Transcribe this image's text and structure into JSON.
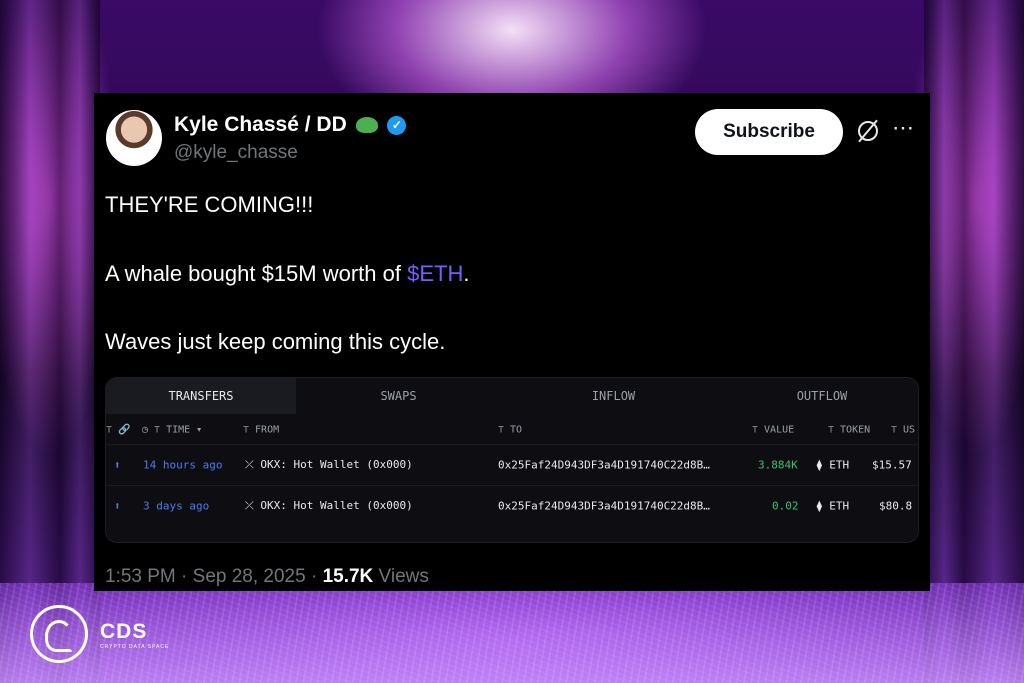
{
  "background": {
    "accent": "#b93cff"
  },
  "tweet": {
    "author_name": "Kyle Chassé / DD",
    "handle": "@kyle_chasse",
    "subscribe_label": "Subscribe",
    "more_icon": "⋯",
    "line1": "THEY'RE COMING!!!",
    "line2_prefix": "A whale bought $15M worth of ",
    "line2_cashtag": "$ETH",
    "line2_suffix": ".",
    "line3": "Waves just keep coming this cycle.",
    "time": "1:53 PM · Sep 28, 2025 · ",
    "views_count": "15.7K",
    "views_label": " Views",
    "cashtag_color": "#7a5cff",
    "verified_color": "#1d9bf0"
  },
  "panel": {
    "tabs": [
      "TRANSFERS",
      "SWAPS",
      "INFLOW",
      "OUTFLOW"
    ],
    "headers": {
      "link_icons": "⊤ 🔗",
      "time": "◷ ⊤ TIME ▾",
      "from": "⊤ FROM",
      "to": "⊤ TO",
      "value": "⊤ VALUE",
      "token": "⊤ TOKEN",
      "usd": "⊤ US"
    },
    "rows": [
      {
        "icon": "⬆",
        "time": "14 hours ago",
        "from": "⤫ OKX: Hot Wallet (0x000)",
        "to": "0x25Faf24D943DF3a4D191740C22d8B…",
        "value": "3.884K",
        "token": "⧫ ETH",
        "usd": "$15.57"
      },
      {
        "icon": "⬆",
        "time": "3 days ago",
        "from": "⤫ OKX: Hot Wallet (0x000)",
        "to": "0x25Faf24D943DF3a4D191740C22d8B…",
        "value": "0.02",
        "token": "⧫ ETH",
        "usd": "$80.8"
      }
    ]
  },
  "brand": {
    "name": "CDS",
    "subtitle": "CRYPTO DATA SPACE"
  }
}
